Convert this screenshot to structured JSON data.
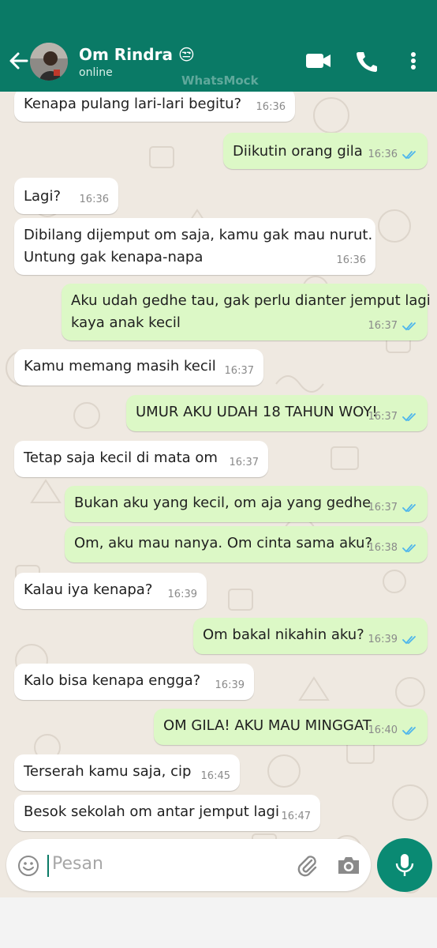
{
  "header": {
    "contact_name": "Om Rindra",
    "contact_emoji": "😒",
    "status": "online",
    "watermark": "WhatsMock",
    "bg_color": "#0a7a66"
  },
  "icons": {
    "back": "arrow-left-icon",
    "video": "video-call-icon",
    "phone": "phone-call-icon",
    "menu": "more-vertical-icon",
    "emoji": "emoji-icon",
    "attach": "paperclip-icon",
    "camera": "camera-icon",
    "mic": "microphone-icon"
  },
  "messages": [
    {
      "dir": "in",
      "text": "Kenapa pulang lari-lari begitu?",
      "time": "16:36"
    },
    {
      "dir": "out",
      "text": "Diikutin orang gila",
      "time": "16:36",
      "read": true
    },
    {
      "dir": "in",
      "text": "Lagi?",
      "time": "16:36"
    },
    {
      "dir": "in",
      "text": "Dibilang dijemput om saja, kamu gak mau nurut.",
      "text2": "Untung gak kenapa-napa",
      "time": "16:36"
    },
    {
      "dir": "out",
      "text": "Aku udah gedhe tau, gak perlu dianter jemput lagi",
      "text2": "kaya anak kecil",
      "time": "16:37",
      "read": true
    },
    {
      "dir": "in",
      "text": "Kamu memang masih kecil",
      "time": "16:37"
    },
    {
      "dir": "out",
      "text": "UMUR AKU UDAH 18 TAHUN WOY!",
      "time": "16:37",
      "read": true
    },
    {
      "dir": "in",
      "text": "Tetap saja kecil di mata om",
      "time": "16:37"
    },
    {
      "dir": "out",
      "text": "Bukan aku yang kecil, om aja yang gedhe",
      "time": "16:37",
      "read": true
    },
    {
      "dir": "out",
      "text": "Om, aku mau nanya. Om cinta sama aku?",
      "time": "16:38",
      "read": true
    },
    {
      "dir": "in",
      "text": "Kalau iya kenapa?",
      "time": "16:39"
    },
    {
      "dir": "out",
      "text": "Om bakal nikahin aku?",
      "time": "16:39",
      "read": true
    },
    {
      "dir": "in",
      "text": "Kalo bisa kenapa engga?",
      "time": "16:39"
    },
    {
      "dir": "out",
      "text": "OM GILA! AKU MAU MINGGAT",
      "time": "16:40",
      "read": true
    },
    {
      "dir": "in",
      "text": "Terserah kamu saja, cip",
      "time": "16:45"
    },
    {
      "dir": "in",
      "text": "Besok sekolah om antar jemput lagi",
      "time": "16:47"
    }
  ],
  "input": {
    "placeholder": "Pesan"
  },
  "colors": {
    "incoming_bubble": "#ffffff",
    "outgoing_bubble": "#dcf8c6",
    "read_ticks": "#4fb6ec",
    "fab": "#0a8a73"
  }
}
